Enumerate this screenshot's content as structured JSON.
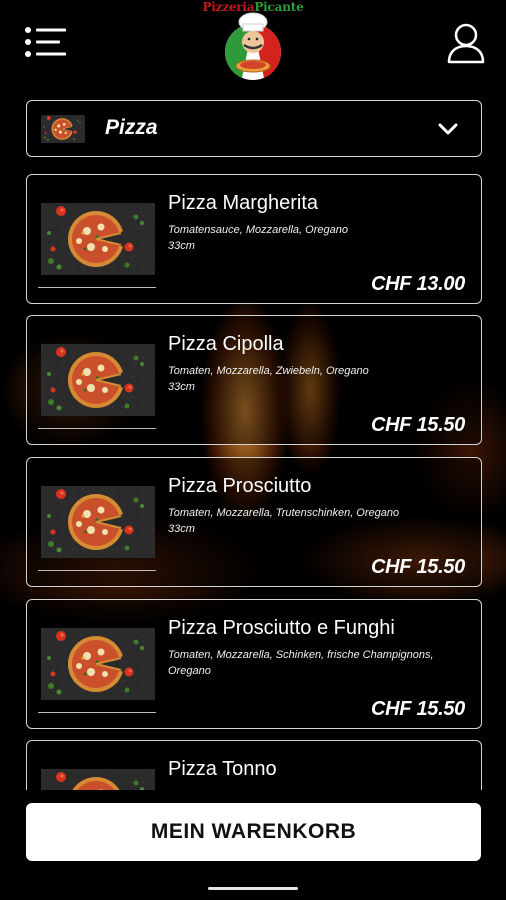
{
  "header": {
    "logo_text": "PizzeriaPicante",
    "logo_part1": "Pizzeria",
    "logo_part2": "Picante",
    "menu_icon": "hamburger-menu-icon",
    "user_icon": "user-profile-icon"
  },
  "category": {
    "selected": "Pizza",
    "icon": "chevron-down-icon"
  },
  "products": [
    {
      "name": "Pizza Margherita",
      "description": "Tomatensauce, Mozzarella, Oregano",
      "size": "33cm",
      "price": "CHF 13.00"
    },
    {
      "name": "Pizza Cipolla",
      "description": "Tomaten, Mozzarella, Zwiebeln, Oregano",
      "size": "33cm",
      "price": "CHF 15.50"
    },
    {
      "name": "Pizza Prosciutto",
      "description": "Tomaten, Mozzarella, Trutenschinken, Oregano",
      "size": "33cm",
      "price": "CHF 15.50"
    },
    {
      "name": "Pizza Prosciutto e Funghi",
      "description": "Tomaten, Mozzarella, Schinken, frische Champignons, Oregano",
      "size": "",
      "price": "CHF 15.50"
    },
    {
      "name": "Pizza Tonno",
      "description": "",
      "size": "",
      "price": ""
    }
  ],
  "cart": {
    "label": "MEIN WARENKORB"
  },
  "colors": {
    "background": "#000000",
    "card_border": "#d4d4d4",
    "button_bg": "#ffffff",
    "logo_red": "#c21a1a",
    "logo_green": "#2e9a3a"
  }
}
